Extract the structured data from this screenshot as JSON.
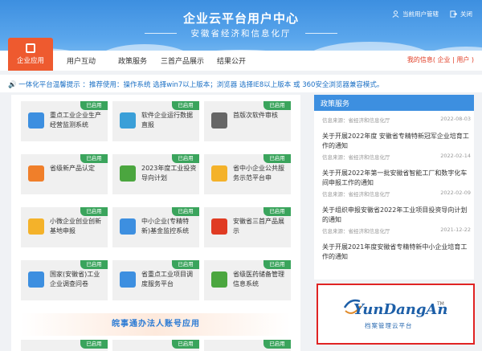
{
  "header": {
    "title": "企业云平台用户中心",
    "subtitle": "安徽省经济和信息化厅",
    "link_user_mgmt": "当前用户管辖",
    "link_exit": "关闭"
  },
  "nav": {
    "active": "企业应用",
    "items": [
      "用户互动",
      "政策服务",
      "三首产品展示",
      "结果公开"
    ],
    "my_info": "我的信息( 企业 | 用户 )"
  },
  "notice": "一体化平台温馨提示 ：推荐使用：操作系统 选择win7以上版本；浏览器 选择IE8以上版本 或 360安全浏览器兼容模式。",
  "badge": "已启用",
  "tiles": [
    {
      "label": "重点工业企业生产经营监测系统",
      "color": "#3d8fe0"
    },
    {
      "label": "软件企业运行数据直报",
      "color": "#3a9fd8"
    },
    {
      "label": "首版次软件审核",
      "color": "#666666"
    },
    {
      "label": "省级新产品认定",
      "color": "#f07f2a"
    },
    {
      "label": "2023年度工业投资导向计划",
      "color": "#4ba63f"
    },
    {
      "label": "省中小企业公共服务示范平台申",
      "color": "#f4b22a"
    },
    {
      "label": "小微企业创业创新基地申报",
      "color": "#f4b22a"
    },
    {
      "label": "中小企业(专精特新)基金监控系统",
      "color": "#3d8fe0"
    },
    {
      "label": "安徽省三首产品展示",
      "color": "#e03b23"
    },
    {
      "label": "国家(安徽省)工业企业调查问卷",
      "color": "#3d8fe0"
    },
    {
      "label": "省重点工业项目调度服务平台",
      "color": "#3d8fe0"
    },
    {
      "label": "省级医药储备管理信息系统",
      "color": "#4ba63f"
    }
  ],
  "banner": "皖事通办法人账号应用",
  "policy": {
    "title": "政策服务",
    "source_label": "信息来源：省经济和信息化厅",
    "items": [
      {
        "title": "",
        "date": "2022-08-03"
      },
      {
        "title": "关于开展2022年度 安徽省专精特新冠军企业培育工作的通知",
        "date": "2022-02-14"
      },
      {
        "title": "关于开展2022年第一批安徽省智能工厂和数字化车间申报工作的通知",
        "date": "2022-02-09"
      },
      {
        "title": "关于组织申报安徽省2022年工业项目投资导向计划的通知",
        "date": "2021-12-22"
      },
      {
        "title": "关于开展2021年度安徽省专精特新中小企业培育工作的通知",
        "date": ""
      }
    ]
  },
  "logo": {
    "name": "YunDangAn",
    "tm": "TM",
    "sub": "档案管理云平台"
  }
}
